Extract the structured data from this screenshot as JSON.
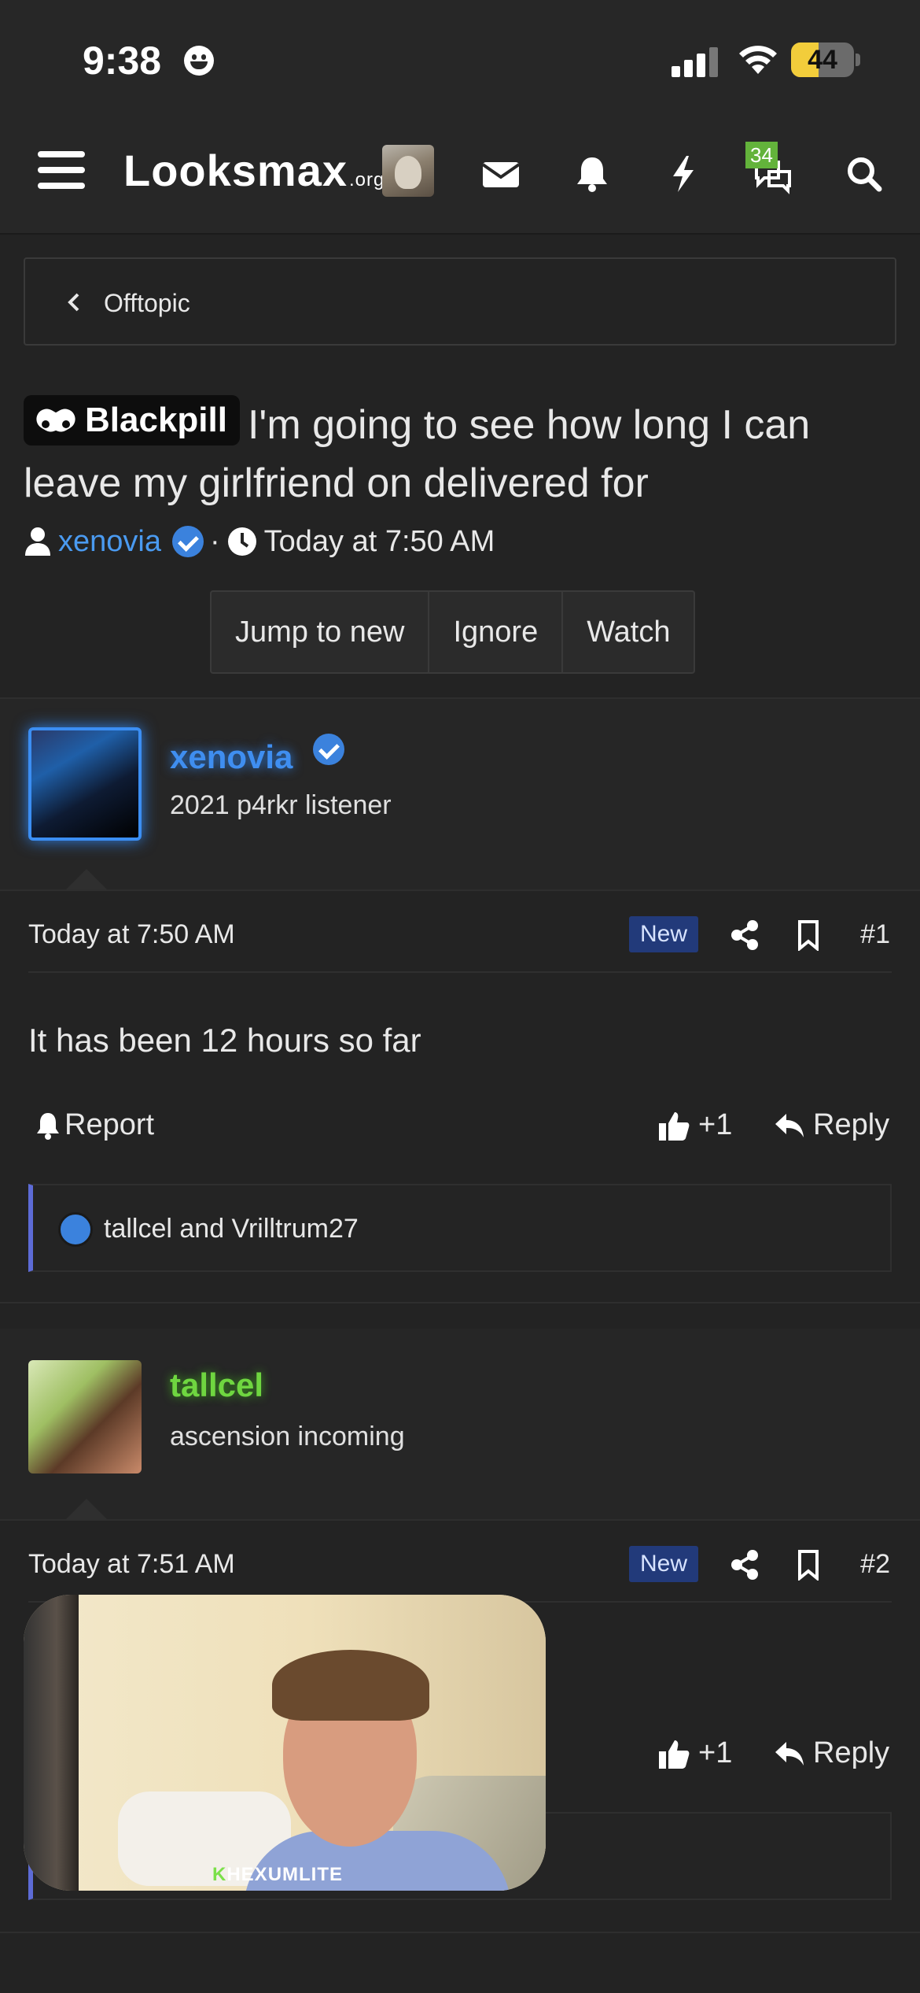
{
  "status_bar": {
    "time": "9:38",
    "battery": "44"
  },
  "header": {
    "logo": "Looksmax",
    "logo_suffix": ".org",
    "chat_badge": "34"
  },
  "breadcrumb": {
    "label": "Offtopic"
  },
  "thread": {
    "prefix": "Blackpill",
    "title": "I'm going to see how long I can leave my girlfriend on delivered for",
    "author": "xenovia",
    "separator": "·",
    "date": "Today at 7:50 AM",
    "buttons": [
      "Jump to new",
      "Ignore",
      "Watch"
    ]
  },
  "posts": [
    {
      "username": "xenovia",
      "user_title": "2021 p4rkr listener",
      "date": "Today at 7:50 AM",
      "badge": "New",
      "number": "#1",
      "body": "It has been 12 hours so far",
      "report_label": "Report",
      "like_label": "+1",
      "reply_label": "Reply",
      "reactions": "tallcel and Vrilltrum27",
      "name_color": "#3f8ef0"
    },
    {
      "username": "tallcel",
      "user_title": "ascension incoming",
      "date": "Today at 7:51 AM",
      "badge": "New",
      "number": "#2",
      "like_label": "+1",
      "reply_label": "Reply",
      "name_color": "#6fd640"
    }
  ],
  "video": {
    "watermark_k": "K",
    "watermark": "HEXUMLITE"
  }
}
